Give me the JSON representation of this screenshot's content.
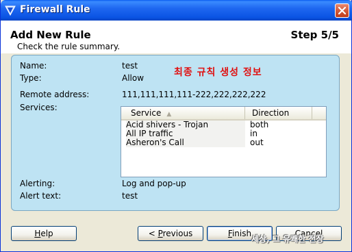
{
  "window": {
    "title": "Firewall Rule"
  },
  "header": {
    "title": "Add New Rule",
    "subtitle": "Check the rule summary.",
    "step": "Step 5/5"
  },
  "summary": {
    "name_label": "Name:",
    "name_value": "test",
    "type_label": "Type:",
    "type_value": "Allow",
    "remote_label": "Remote address:",
    "remote_value": "111,111,111,111-222,222,222,222",
    "services_label": "Services:",
    "alerting_label": "Alerting:",
    "alerting_value": "Log and pop-up",
    "alert_text_label": "Alert text:",
    "alert_text_value": "test"
  },
  "annotation": "최종 규칙 생성 정보",
  "services": {
    "columns": [
      "Service",
      "Direction"
    ],
    "rows": [
      {
        "service": "Acid shivers - Trojan",
        "direction": "both"
      },
      {
        "service": "All IP traffic",
        "direction": "in"
      },
      {
        "service": "Asheron's Call",
        "direction": "out"
      }
    ]
  },
  "buttons": {
    "help": {
      "mnemonic": "H",
      "rest": "elp"
    },
    "previous": {
      "prefix": "< ",
      "mnemonic": "P",
      "rest": "revious"
    },
    "finish": {
      "mnemonic": "F",
      "rest": "inish"
    },
    "cancel": "Cancel"
  },
  "watermark": "세상, 그 유쾌한 전장",
  "colors": {
    "title_bar": "#0a53e3",
    "panel_bg": "#bee3f3",
    "annotation_red": "#e01010"
  }
}
